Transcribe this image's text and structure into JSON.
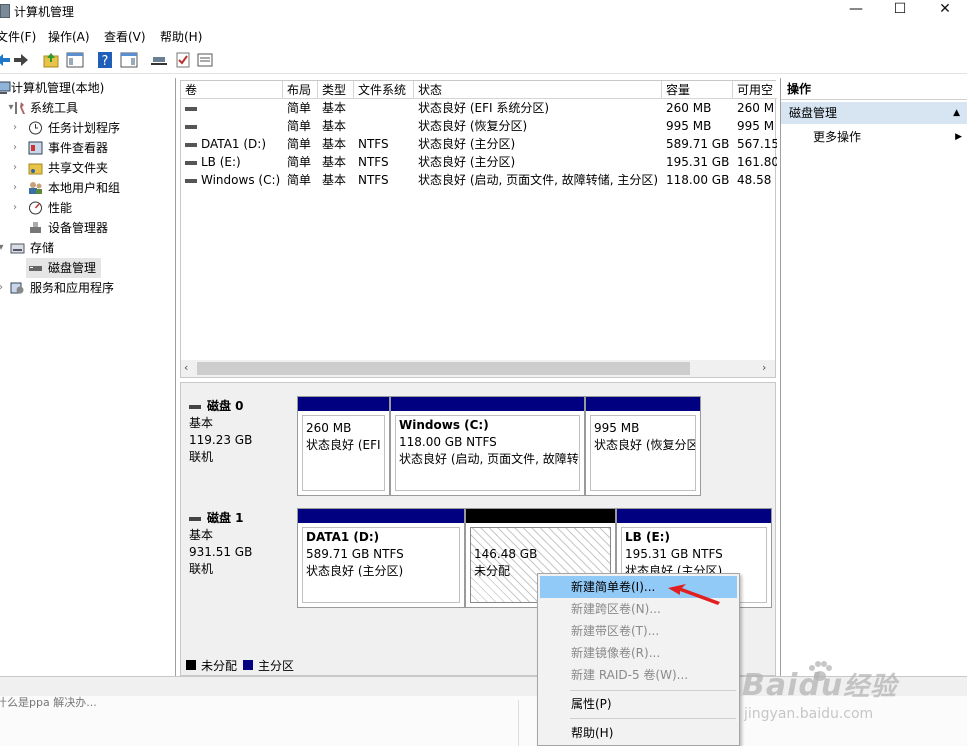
{
  "window": {
    "title": "计算机管理",
    "controls": [
      "—",
      "☐",
      "✕"
    ]
  },
  "menu": [
    "文件(F)",
    "操作(A)",
    "查看(V)",
    "帮助(H)"
  ],
  "tree": {
    "root": "计算机管理(本地)",
    "system_tools": "系统工具",
    "task_scheduler": "任务计划程序",
    "event_viewer": "事件查看器",
    "shared_folders": "共享文件夹",
    "local_users": "本地用户和组",
    "performance": "性能",
    "device_manager": "设备管理器",
    "storage": "存储",
    "disk_management": "磁盘管理",
    "services_apps": "服务和应用程序"
  },
  "table": {
    "headers": [
      "卷",
      "布局",
      "类型",
      "文件系统",
      "状态",
      "容量",
      "可用空"
    ],
    "rows": [
      {
        "vol": "",
        "layout": "简单",
        "type": "基本",
        "fs": "",
        "status": "状态良好 (EFI 系统分区)",
        "cap": "260 MB",
        "free": "260 M"
      },
      {
        "vol": "",
        "layout": "简单",
        "type": "基本",
        "fs": "",
        "status": "状态良好 (恢复分区)",
        "cap": "995 MB",
        "free": "995 M"
      },
      {
        "vol": "DATA1 (D:)",
        "layout": "简单",
        "type": "基本",
        "fs": "NTFS",
        "status": "状态良好 (主分区)",
        "cap": "589.71 GB",
        "free": "567.15"
      },
      {
        "vol": "LB (E:)",
        "layout": "简单",
        "type": "基本",
        "fs": "NTFS",
        "status": "状态良好 (主分区)",
        "cap": "195.31 GB",
        "free": "161.80"
      },
      {
        "vol": "Windows (C:)",
        "layout": "简单",
        "type": "基本",
        "fs": "NTFS",
        "status": "状态良好 (启动, 页面文件, 故障转储, 主分区)",
        "cap": "118.00 GB",
        "free": "48.58"
      }
    ]
  },
  "disks": [
    {
      "name": "磁盘 0",
      "type": "基本",
      "size": "119.23 GB",
      "state": "联机",
      "partitions": [
        {
          "title": "",
          "size": "260 MB",
          "status": "状态良好 (EFI"
        },
        {
          "title": "Windows (C:)",
          "size": "118.00 GB NTFS",
          "status": "状态良好 (启动, 页面文件, 故障转"
        },
        {
          "title": "",
          "size": "995 MB",
          "status": "状态良好 (恢复分区"
        }
      ]
    },
    {
      "name": "磁盘 1",
      "type": "基本",
      "size": "931.51 GB",
      "state": "联机",
      "partitions": [
        {
          "title": "DATA1 (D:)",
          "size": "589.71 GB NTFS",
          "status": "状态良好 (主分区)"
        },
        {
          "title": "",
          "size": "146.48 GB",
          "status": "未分配"
        },
        {
          "title": "LB (E:)",
          "size": "195.31 GB NTFS",
          "status": "状态良好 (主分区)"
        }
      ]
    }
  ],
  "legend": {
    "unallocated": "未分配",
    "primary": "主分区"
  },
  "actions": {
    "header": "操作",
    "section": "磁盘管理",
    "more": "更多操作"
  },
  "context_menu": {
    "new_simple": "新建简单卷(I)...",
    "new_spanned": "新建跨区卷(N)...",
    "new_striped": "新建带区卷(T)...",
    "new_mirrored": "新建镜像卷(R)...",
    "new_raid5": "新建 RAID-5 卷(W)...",
    "properties": "属性(P)",
    "help": "帮助(H)"
  },
  "background_text": "什么是ppa 解决办...",
  "watermark": {
    "brand": "Baidu",
    "cn": "经验",
    "url": "jingyan.baidu.com"
  },
  "colors": {
    "primary_partition": "#000080",
    "unallocated": "#000000",
    "selection": "#cce8ff",
    "actions_header": "#d7e4f2",
    "arrow": "#e02020"
  }
}
